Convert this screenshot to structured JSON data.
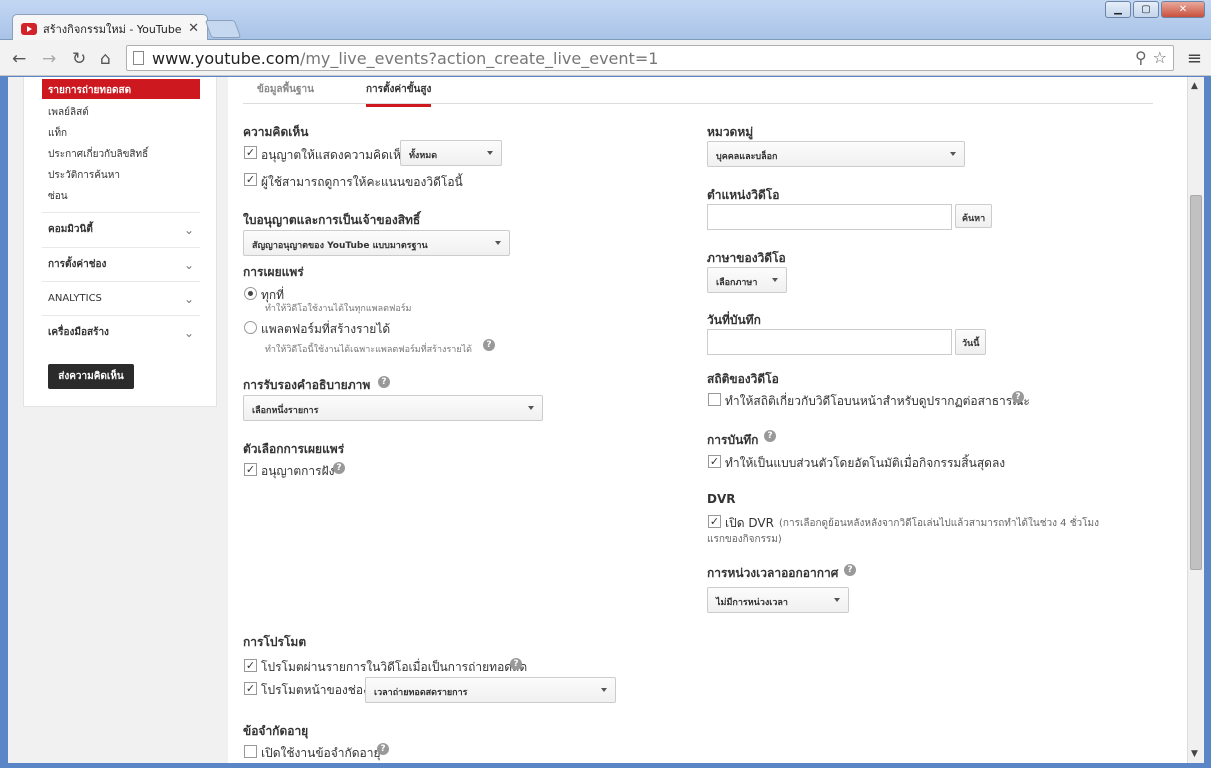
{
  "browser": {
    "tab_title": "สร้างกิจกรรมใหม่ - YouTube",
    "url_host": "www.youtube.com",
    "url_path": "/my_live_events?action_create_live_event=1"
  },
  "sidebar": {
    "active_item": "รายการถ่ายทอดสด",
    "links": [
      "เพลย์ลิสต์",
      "แท็ก",
      "ประกาศเกี่ยวกับลิขสิทธิ์",
      "ประวัติการค้นหา",
      "ซ่อน"
    ],
    "sections": [
      "คอมมิวนิตี้",
      "การตั้งค่าช่อง",
      "ANALYTICS",
      "เครื่องมือสร้าง"
    ],
    "feedback_label": "ส่งความคิดเห็น"
  },
  "tabs": [
    "ข้อมูลพื้นฐาน",
    "การตั้งค่าขั้นสูง"
  ],
  "left": {
    "comments_heading": "ความคิดเห็น",
    "allow_comments": "อนุญาตให้แสดงความคิดเห็น",
    "comments_select": "ทั้งหมด",
    "users_can_rate": "ผู้ใช้สามารถดูการให้คะแนนของวิดีโอนี้",
    "license_heading": "ใบอนุญาตและการเป็นเจ้าของสิทธิ์",
    "license_select": "สัญญาอนุญาตของ YouTube แบบมาตรฐาน",
    "distribution_heading": "การเผยแพร่",
    "everywhere": "ทุกที่",
    "everywhere_sub": "ทำให้วิดีโอใช้งานได้ในทุกแพลตฟอร์ม",
    "monetized": "แพลตฟอร์มที่สร้างรายได้",
    "monetized_sub": "ทำให้วิดีโอนี้ใช้งานได้เฉพาะแพลตฟอร์มที่สร้างรายได้",
    "caption_heading": "การรับรองคำอธิบายภาพ",
    "caption_select": "เลือกหนึ่งรายการ",
    "dist_options_heading": "ตัวเลือกการเผยแพร่",
    "allow_embed": "อนุญาตการฝัง",
    "promo_heading": "การโปรโมต",
    "promo_watch": "โปรโมตผ่านรายการในวิดีโอเมื่อเป็นการถ่ายทอดสด",
    "promo_channel": "โปรโมตหน้าของช่อง",
    "promo_select": "เวลาถ่ายทอดสดรายการ",
    "age_heading": "ข้อจำกัดอายุ",
    "age_enable": "เปิดใช้งานข้อจำกัดอายุ"
  },
  "right": {
    "category_heading": "หมวดหมู่",
    "category_select": "บุคคลและบล็อก",
    "location_heading": "ตำแหน่งวิดีโอ",
    "search_btn": "ค้นหา",
    "language_heading": "ภาษาของวิดีโอ",
    "language_select": "เลือกภาษา",
    "date_heading": "วันที่บันทึก",
    "today_btn": "วันนี้",
    "stats_heading": "สถิติของวิดีโอ",
    "stats_label": "ทำให้สถิติเกี่ยวกับวิดีโอบนหน้าสำหรับดูปรากฏต่อสาธารณะ",
    "recording_heading": "การบันทึก",
    "recording_label": "ทำให้เป็นแบบส่วนตัวโดยอัตโนมัติเมื่อกิจกรรมสิ้นสุดลง",
    "dvr_heading": "DVR",
    "dvr_label": "เปิด DVR",
    "dvr_desc_1": "(การเลือกดูย้อนหลังหลังจากวิดีโอเล่นไปแล้วสามารถทำได้ในช่วง 4 ชั่วโมง",
    "dvr_desc_2": "แรกของกิจกรรม)",
    "delay_heading": "การหน่วงเวลาออกอากาศ",
    "delay_select": "ไม่มีการหน่วงเวลา"
  }
}
